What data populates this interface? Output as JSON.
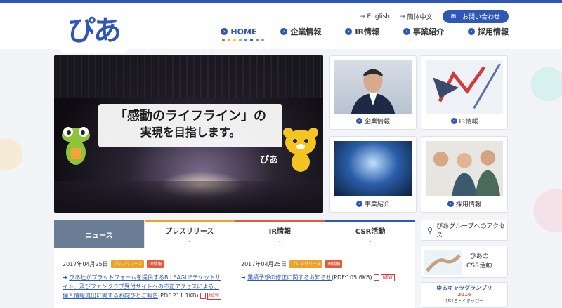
{
  "header": {
    "logo": "ぴあ",
    "util": {
      "english": "English",
      "chinese": "簡体中文",
      "contact": "お問い合わせ"
    },
    "nav": [
      {
        "label": "HOME",
        "active": true
      },
      {
        "label": "企業情報"
      },
      {
        "label": "IR情報"
      },
      {
        "label": "事業紹介"
      },
      {
        "label": "採用情報"
      }
    ]
  },
  "hero": {
    "line1": "「感動のライフライン」の",
    "line2": "実現を目指します。",
    "sign": "ぴあ"
  },
  "cards": {
    "corporate": "企業情報",
    "ir": "IR情報",
    "business": "事業紹介",
    "recruit": "採用情報"
  },
  "side": {
    "access": "ぴあグループへのアクセス",
    "csr_line1": "ぴあの",
    "csr_line2": "CSR活動",
    "yuru_title": "ゆるキャラグランプリ",
    "yuru_year": "2016",
    "yuru_sub": "ぴけろ・くまッぴー"
  },
  "tabs": [
    {
      "label": "ニュース",
      "active": true,
      "color": "#6b7d95"
    },
    {
      "label": "プレスリリース",
      "color": "#f0a12a"
    },
    {
      "label": "IR情報",
      "color": "#e55a3a"
    },
    {
      "label": "CSR活動",
      "color": "#2f57b8"
    }
  ],
  "news": {
    "left": {
      "date": "2017年04月25日",
      "badge1": "プレスリリース",
      "badge2": "IR情報",
      "text": "ぴあ社がプラットフォームを提供するB.LEAGUEチケットサイト、及びファンクラブ受付サイトへの不正アクセスによる、個人情報流出に関するお詫びとご報告",
      "suffix": "(PDF:211.1KB)",
      "new": "NEW"
    },
    "right": {
      "date": "2017年04月25日",
      "badge1": "プレスリリース",
      "badge2": "IR情報",
      "text": "業績予想の修正に関するお知らせ",
      "suffix": "(PDF:105.6KB)",
      "new": "NEW"
    }
  },
  "colors": {
    "brand": "#2f57b8",
    "press": "#f0a12a",
    "ir": "#e55a3a"
  }
}
